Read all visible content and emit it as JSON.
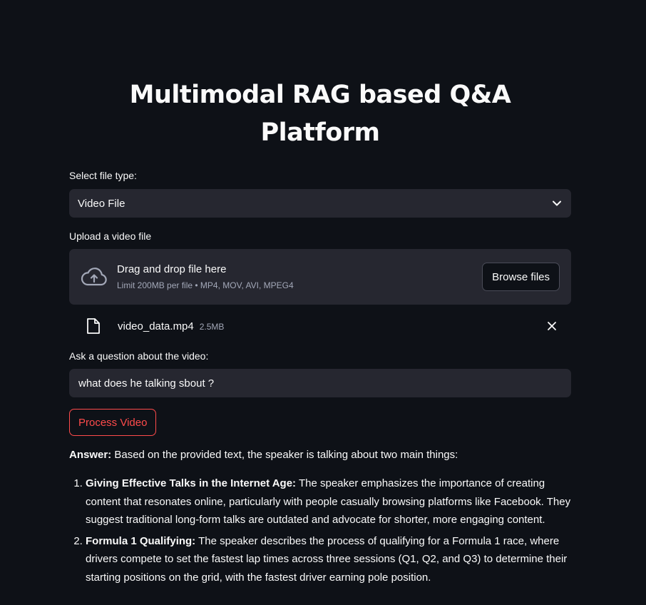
{
  "page": {
    "title_line1": "Multimodal RAG based Q&A",
    "title_line2": "Platform"
  },
  "file_type": {
    "label": "Select file type:",
    "selected": "Video File",
    "chevron_icon": "chevron-down-icon"
  },
  "uploader": {
    "label": "Upload a video file",
    "dropzone_text": "Drag and drop file here",
    "limits": "Limit 200MB per file • MP4, MOV, AVI, MPEG4",
    "browse_label": "Browse files",
    "icon": "cloud-upload-icon"
  },
  "uploaded_file": {
    "name": "video_data.mp4",
    "size": "2.5MB",
    "icon": "file-icon",
    "remove_icon": "close-icon"
  },
  "question": {
    "label": "Ask a question about the video:",
    "value": "what does he talking sbout ?"
  },
  "process_button": {
    "label": "Process Video"
  },
  "answer": {
    "prefix": "Answer:",
    "intro": "Based on the provided text, the speaker is talking about two main things:",
    "points": [
      {
        "title": "Giving Effective Talks in the Internet Age:",
        "text": "The speaker emphasizes the importance of creating content that resonates online, particularly with people casually browsing platforms like Facebook. They suggest traditional long-form talks are outdated and advocate for shorter, more engaging content."
      },
      {
        "title": "Formula 1 Qualifying:",
        "text": "The speaker describes the process of qualifying for a Formula 1 race, where drivers compete to set the fastest lap times across three sessions (Q1, Q2, and Q3) to determine their starting positions on the grid, with the fastest driver earning pole position."
      }
    ]
  },
  "colors": {
    "background": "#0e1117",
    "widget": "#262730",
    "accent": "#ff4b4b",
    "muted_text": "#a3a8b8"
  }
}
